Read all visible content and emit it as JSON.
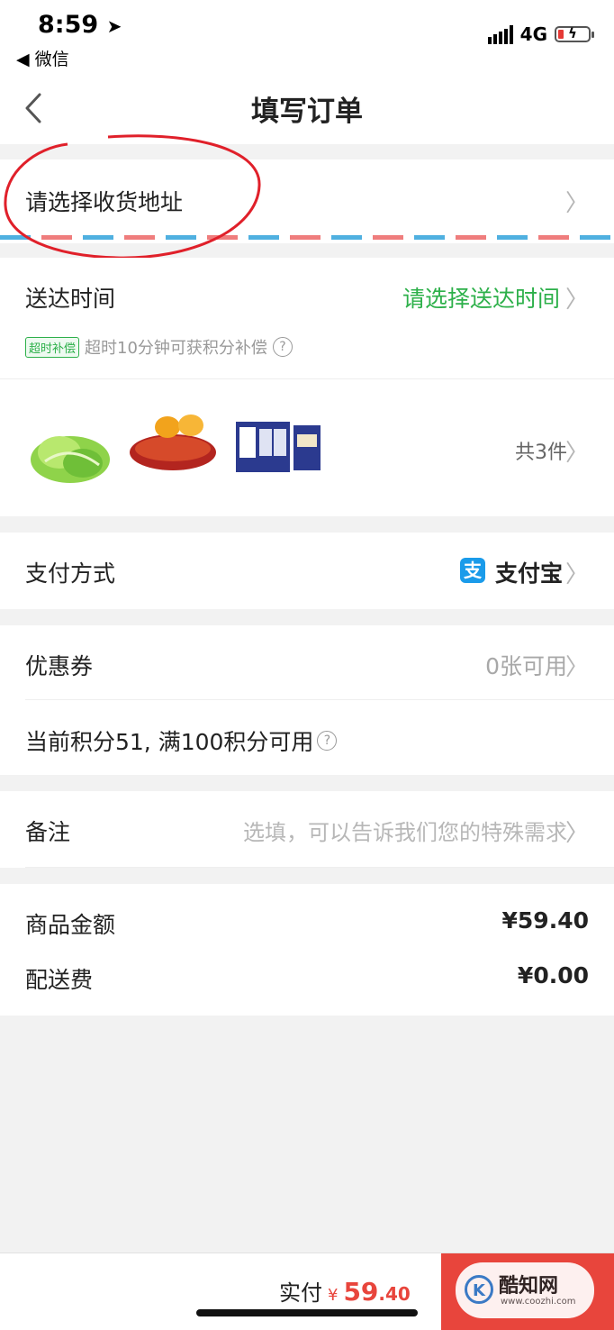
{
  "status_bar": {
    "time": "8:59",
    "back_app": "◀ 微信",
    "network": "4G"
  },
  "nav": {
    "title": "填写订单"
  },
  "address": {
    "placeholder": "请选择收货地址"
  },
  "delivery": {
    "label": "送达时间",
    "action": "请选择送达时间",
    "badge": "超时补偿",
    "note": "超时10分钟可获积分补偿"
  },
  "products": {
    "count_text": "共3件",
    "items": [
      "lettuce",
      "sweet-potato",
      "milk-box"
    ]
  },
  "payment": {
    "label": "支付方式",
    "method": "支付宝",
    "icon_glyph": "支"
  },
  "coupon": {
    "label": "优惠券",
    "value": "0张可用"
  },
  "points": {
    "text": "当前积分51, 满100积分可用"
  },
  "remark": {
    "label": "备注",
    "placeholder": "选填，可以告诉我们您的特殊需求"
  },
  "summary": {
    "goods_label": "商品金额",
    "goods_value": "¥59.40",
    "shipping_label": "配送费",
    "shipping_value": "¥0.00"
  },
  "footer": {
    "paid_label": "实付",
    "currency": "¥",
    "amount_main": "59",
    "amount_dec": ".40"
  },
  "watermark": {
    "name": "酷知网",
    "url": "www.coozhi.com"
  },
  "colors": {
    "accent_green": "#2db04a",
    "price_red": "#e8453c",
    "alipay_blue": "#1a9bea",
    "annotation_red": "#e0202a"
  }
}
